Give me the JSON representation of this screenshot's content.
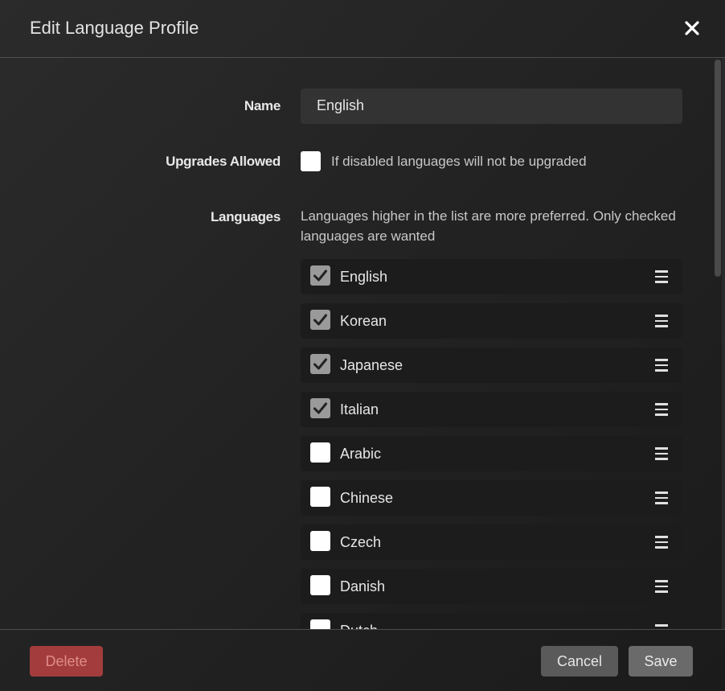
{
  "dialog": {
    "title": "Edit Language Profile",
    "close_icon": "close-icon"
  },
  "form": {
    "name_label": "Name",
    "name_value": "English",
    "upgrades_label": "Upgrades Allowed",
    "upgrades_checked": false,
    "upgrades_help": "If disabled languages will not be upgraded",
    "languages_label": "Languages",
    "languages_help": "Languages higher in the list are more preferred. Only checked languages are wanted"
  },
  "languages": [
    {
      "label": "English",
      "checked": true
    },
    {
      "label": "Korean",
      "checked": true
    },
    {
      "label": "Japanese",
      "checked": true
    },
    {
      "label": "Italian",
      "checked": true
    },
    {
      "label": "Arabic",
      "checked": false
    },
    {
      "label": "Chinese",
      "checked": false
    },
    {
      "label": "Czech",
      "checked": false
    },
    {
      "label": "Danish",
      "checked": false
    },
    {
      "label": "Dutch",
      "checked": false
    }
  ],
  "footer": {
    "delete_label": "Delete",
    "cancel_label": "Cancel",
    "save_label": "Save"
  },
  "colors": {
    "delete": "#a33c3c",
    "cancel": "#5a5a5a",
    "save": "#6a6a6a",
    "checked": "#9a9a9a"
  }
}
